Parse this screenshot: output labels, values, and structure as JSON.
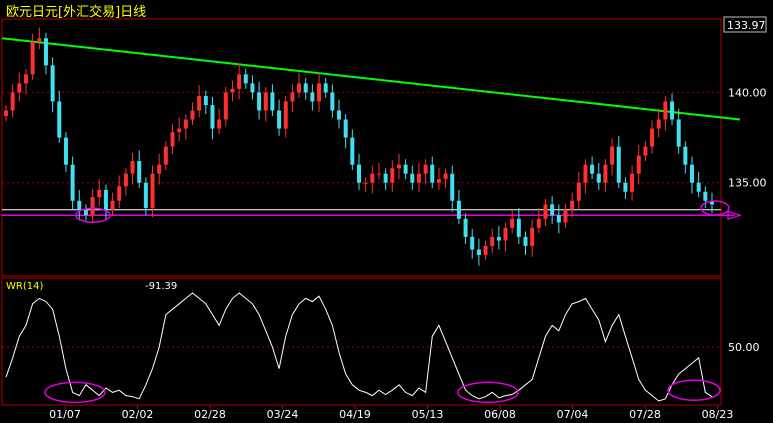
{
  "title": "欧元日元[外汇交易]日线",
  "colors": {
    "background": "#000000",
    "frame": "#b00000",
    "up_candle": "#ff3030",
    "down_candle": "#40e0f0",
    "trendline": "#00ff00",
    "support_line": "#e000e0",
    "wr_line": "#ffffff",
    "grid": "#a00000",
    "axis_text": "#ffffff",
    "title_text": "#ffff00"
  },
  "chart_data": [
    {
      "type": "candlestick",
      "title": "欧元日元[外汇交易]日线",
      "price_label": "133.97",
      "y_ticks": [
        {
          "value": 140.0,
          "label": "140.00"
        },
        {
          "value": 135.0,
          "label": "135.00"
        }
      ],
      "ylim": [
        130.0,
        143.9
      ],
      "x_tick_labels": [
        "01/07",
        "02/02",
        "02/28",
        "03/24",
        "04/19",
        "05/13",
        "06/08",
        "07/04",
        "07/28",
        "08/23"
      ],
      "trendline": {
        "start_value": 143.0,
        "end_value": 138.5,
        "color_key": "trendline"
      },
      "support_level": 133.2,
      "horizontal_line": 133.5,
      "highlight_ellipses": [
        {
          "anchor": "01/07",
          "value": 133.2
        },
        {
          "anchor": "08/23",
          "value": 133.6
        }
      ],
      "closes": [
        139.0,
        140.0,
        140.5,
        141.0,
        142.8,
        143.0,
        141.5,
        139.5,
        137.5,
        136.0,
        134.0,
        133.5,
        133.2,
        134.2,
        134.6,
        133.5,
        134.0,
        134.8,
        135.5,
        136.2,
        135.0,
        133.6,
        135.5,
        136.0,
        137.0,
        137.8,
        138.0,
        138.5,
        139.0,
        139.8,
        139.3,
        138.0,
        138.5,
        140.0,
        140.2,
        141.0,
        140.5,
        140.0,
        139.0,
        140.0,
        139.0,
        138.0,
        139.5,
        140.0,
        140.5,
        140.0,
        139.5,
        140.5,
        140.0,
        139.0,
        138.5,
        137.5,
        136.0,
        135.0,
        135.0,
        135.5,
        135.5,
        135.0,
        135.8,
        136.0,
        135.5,
        135.0,
        135.5,
        136.0,
        135.0,
        135.2,
        135.5,
        134.0,
        133.0,
        132.0,
        131.3,
        131.0,
        131.5,
        132.0,
        131.8,
        132.5,
        133.0,
        132.0,
        131.5,
        132.5,
        133.0,
        133.8,
        133.2,
        132.8,
        133.5,
        134.0,
        135.0,
        136.0,
        135.5,
        135.0,
        136.0,
        137.0,
        135.0,
        134.5,
        135.5,
        136.5,
        137.0,
        138.0,
        138.5,
        139.5,
        138.5,
        137.0,
        136.0,
        135.0,
        134.5,
        134.0,
        133.8
      ],
      "sub_chart": {
        "label": "WR(14)",
        "value_label": "-91.39",
        "ylim": [
          0,
          100
        ],
        "level": {
          "value": 50,
          "label": "50.00"
        },
        "highlight_ellipses": [
          {
            "anchor": "01/07",
            "value": 92
          },
          {
            "anchor": "06/08",
            "value": 92
          },
          {
            "anchor": "08/23",
            "value": 90
          }
        ],
        "wr_values": [
          78,
          60,
          40,
          30,
          10,
          5,
          8,
          15,
          40,
          70,
          92,
          95,
          85,
          90,
          95,
          88,
          92,
          90,
          95,
          96,
          98,
          85,
          70,
          50,
          20,
          15,
          10,
          5,
          0,
          5,
          10,
          20,
          30,
          15,
          5,
          0,
          5,
          10,
          20,
          35,
          50,
          70,
          40,
          20,
          10,
          5,
          8,
          3,
          15,
          30,
          55,
          75,
          85,
          90,
          92,
          95,
          90,
          94,
          90,
          85,
          92,
          95,
          88,
          92,
          40,
          30,
          45,
          60,
          75,
          90,
          95,
          98,
          96,
          92,
          97,
          95,
          94,
          90,
          85,
          80,
          60,
          40,
          30,
          35,
          20,
          10,
          8,
          5,
          15,
          25,
          45,
          30,
          20,
          40,
          60,
          80,
          90,
          95,
          100,
          98,
          85,
          75,
          70,
          65,
          60,
          92,
          96
        ]
      }
    }
  ]
}
